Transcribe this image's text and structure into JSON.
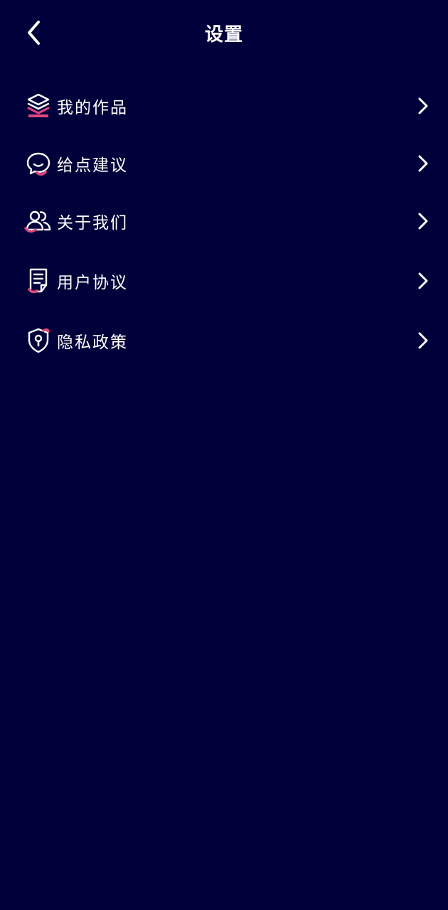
{
  "header": {
    "title": "设置",
    "back_icon": "chevron-left-icon"
  },
  "colors": {
    "background": "#00003a",
    "text": "#ffffff",
    "accent": "#e0467e"
  },
  "menu": {
    "items": [
      {
        "label": "我的作品",
        "icon": "layers-icon"
      },
      {
        "label": "给点建议",
        "icon": "chat-bubble-icon"
      },
      {
        "label": "关于我们",
        "icon": "users-icon"
      },
      {
        "label": "用户协议",
        "icon": "document-icon"
      },
      {
        "label": "隐私政策",
        "icon": "shield-lock-icon"
      }
    ]
  }
}
